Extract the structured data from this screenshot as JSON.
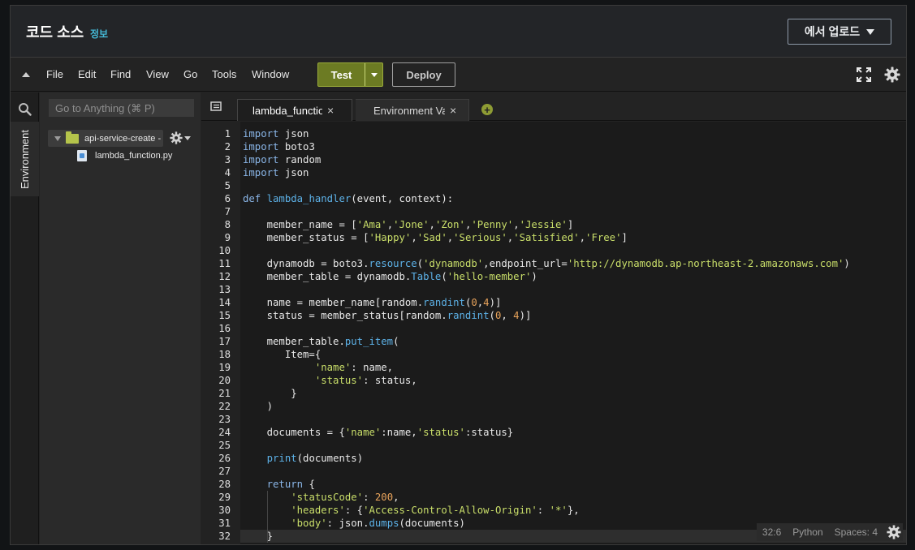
{
  "header": {
    "title": "코드 소스",
    "info_link": "정보",
    "upload_button": "에서 업로드"
  },
  "menubar": {
    "items": [
      "File",
      "Edit",
      "Find",
      "View",
      "Go",
      "Tools",
      "Window"
    ],
    "test_button": "Test",
    "deploy_button": "Deploy"
  },
  "sidebar": {
    "vertical_tab": "Environment",
    "goto_placeholder": "Go to Anything (⌘ P)",
    "root_folder": "api-service-create -",
    "file": "lambda_function.py"
  },
  "tabs": [
    {
      "label": "lambda_function",
      "active": true
    },
    {
      "label": "Environment Vari",
      "active": false
    }
  ],
  "editor": {
    "language": "Python",
    "active_line": 32,
    "lines": [
      [
        [
          "k",
          "import"
        ],
        [
          "p",
          " json"
        ]
      ],
      [
        [
          "k",
          "import"
        ],
        [
          "p",
          " boto3"
        ]
      ],
      [
        [
          "k",
          "import"
        ],
        [
          "p",
          " random"
        ]
      ],
      [
        [
          "k",
          "import"
        ],
        [
          "p",
          " json"
        ]
      ],
      [],
      [
        [
          "k",
          "def"
        ],
        [
          "p",
          " "
        ],
        [
          "f",
          "lambda_handler"
        ],
        [
          "p",
          "(event, context):"
        ]
      ],
      [],
      [
        [
          "p",
          "    member_name = ["
        ],
        [
          "s",
          "'Ama'"
        ],
        [
          "p",
          ","
        ],
        [
          "s",
          "'Jone'"
        ],
        [
          "p",
          ","
        ],
        [
          "s",
          "'Zon'"
        ],
        [
          "p",
          ","
        ],
        [
          "s",
          "'Penny'"
        ],
        [
          "p",
          ","
        ],
        [
          "s",
          "'Jessie'"
        ],
        [
          "p",
          "]"
        ]
      ],
      [
        [
          "p",
          "    member_status = ["
        ],
        [
          "s",
          "'Happy'"
        ],
        [
          "p",
          ","
        ],
        [
          "s",
          "'Sad'"
        ],
        [
          "p",
          ","
        ],
        [
          "s",
          "'Serious'"
        ],
        [
          "p",
          ","
        ],
        [
          "s",
          "'Satisfied'"
        ],
        [
          "p",
          ","
        ],
        [
          "s",
          "'Free'"
        ],
        [
          "p",
          "]"
        ]
      ],
      [],
      [
        [
          "p",
          "    dynamodb = boto3."
        ],
        [
          "f",
          "resource"
        ],
        [
          "p",
          "("
        ],
        [
          "s",
          "'dynamodb'"
        ],
        [
          "p",
          ",endpoint_url="
        ],
        [
          "s",
          "'http://dynamodb.ap-northeast-2.amazonaws.com'"
        ],
        [
          "p",
          ")"
        ]
      ],
      [
        [
          "p",
          "    member_table = dynamodb."
        ],
        [
          "f",
          "Table"
        ],
        [
          "p",
          "("
        ],
        [
          "s",
          "'hello-member'"
        ],
        [
          "p",
          ")"
        ]
      ],
      [],
      [
        [
          "p",
          "    name = member_name[random."
        ],
        [
          "f",
          "randint"
        ],
        [
          "p",
          "("
        ],
        [
          "n",
          "0"
        ],
        [
          "p",
          ","
        ],
        [
          "n",
          "4"
        ],
        [
          "p",
          ")]"
        ]
      ],
      [
        [
          "p",
          "    status = member_status[random."
        ],
        [
          "f",
          "randint"
        ],
        [
          "p",
          "("
        ],
        [
          "n",
          "0"
        ],
        [
          "p",
          ", "
        ],
        [
          "n",
          "4"
        ],
        [
          "p",
          ")]"
        ]
      ],
      [],
      [
        [
          "p",
          "    member_table."
        ],
        [
          "f",
          "put_item"
        ],
        [
          "p",
          "("
        ]
      ],
      [
        [
          "p",
          "       Item={"
        ]
      ],
      [
        [
          "p",
          "            "
        ],
        [
          "s",
          "'name'"
        ],
        [
          "p",
          ": name,"
        ]
      ],
      [
        [
          "p",
          "            "
        ],
        [
          "s",
          "'status'"
        ],
        [
          "p",
          ": status,"
        ]
      ],
      [
        [
          "p",
          "        }"
        ]
      ],
      [
        [
          "p",
          "    )"
        ]
      ],
      [],
      [
        [
          "p",
          "    documents = {"
        ],
        [
          "s",
          "'name'"
        ],
        [
          "p",
          ":name,"
        ],
        [
          "s",
          "'status'"
        ],
        [
          "p",
          ":status}"
        ]
      ],
      [],
      [
        [
          "p",
          "    "
        ],
        [
          "f",
          "print"
        ],
        [
          "p",
          "(documents)"
        ]
      ],
      [],
      [
        [
          "p",
          "    "
        ],
        [
          "k",
          "return"
        ],
        [
          "p",
          " {"
        ]
      ],
      [
        [
          "p",
          "        "
        ],
        [
          "s",
          "'statusCode'"
        ],
        [
          "p",
          ": "
        ],
        [
          "n",
          "200"
        ],
        [
          "p",
          ","
        ]
      ],
      [
        [
          "p",
          "        "
        ],
        [
          "s",
          "'headers'"
        ],
        [
          "p",
          ": {"
        ],
        [
          "s",
          "'Access-Control-Allow-Origin'"
        ],
        [
          "p",
          ": "
        ],
        [
          "s",
          "'*'"
        ],
        [
          "p",
          "},"
        ]
      ],
      [
        [
          "p",
          "        "
        ],
        [
          "s",
          "'body'"
        ],
        [
          "p",
          ": json."
        ],
        [
          "f",
          "dumps"
        ],
        [
          "p",
          "(documents)"
        ]
      ],
      [
        [
          "p",
          "    }"
        ]
      ]
    ]
  },
  "status": {
    "cursor": "32:6",
    "language": "Python",
    "spaces": "Spaces: 4"
  }
}
